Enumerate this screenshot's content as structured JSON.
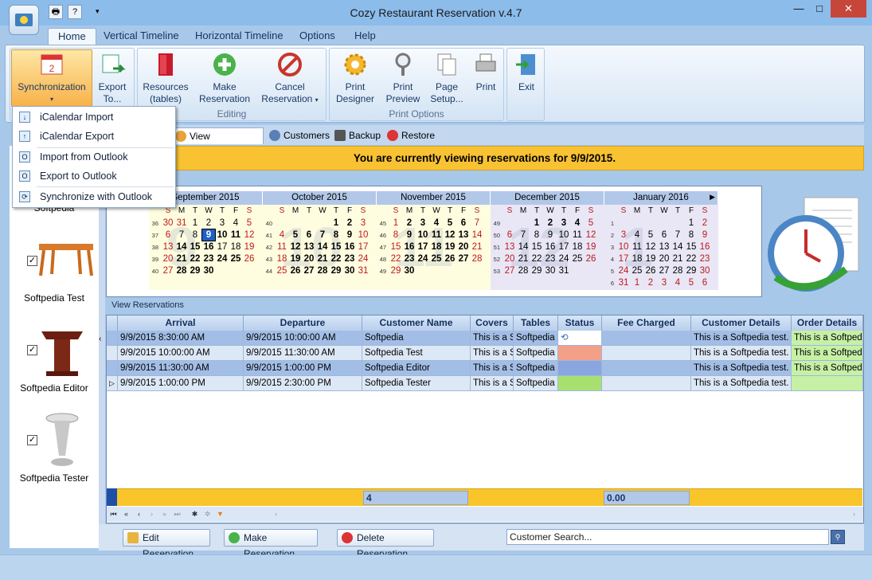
{
  "window": {
    "title": "Cozy Restaurant Reservation v.4.7",
    "minimize": "—",
    "maximize": "□",
    "close": "✕"
  },
  "ribbon_tabs": [
    "Home",
    "Vertical Timeline",
    "Horizontal Timeline",
    "Options",
    "Help"
  ],
  "ribbon": {
    "sync": "Synchronization",
    "export1": "Export",
    "export2": "To...",
    "resources1": "Resources",
    "resources2": "(tables)",
    "make1": "Make",
    "make2": "Reservation",
    "cancel1": "Cancel",
    "cancel2": "Reservation",
    "print_designer1": "Print",
    "print_designer2": "Designer",
    "print_preview1": "Print",
    "print_preview2": "Preview",
    "page_setup1": "Page",
    "page_setup2": "Setup...",
    "print": "Print",
    "exit": "Exit",
    "group_editing": "Editing",
    "group_print": "Print Options"
  },
  "dropdown": [
    "iCalendar Import",
    "iCalendar Export",
    "Import from Outlook",
    "Export to Outlook",
    "Synchronize with Outlook"
  ],
  "view_tabs": [
    "View Reservations",
    "Customers",
    "Backup",
    "Restore"
  ],
  "banner": "You are currently viewing reservations for 9/9/2015.",
  "resources": [
    {
      "name": "Softpedia",
      "checked": true
    },
    {
      "name": "Softpedia Test",
      "checked": true
    },
    {
      "name": "Softpedia Editor",
      "checked": true
    },
    {
      "name": "Softpedia Tester",
      "checked": true
    }
  ],
  "calendar": {
    "dow": [
      "S",
      "M",
      "T",
      "W",
      "T",
      "F",
      "S"
    ],
    "months": [
      {
        "name": "September 2015",
        "watermark": "9",
        "weeks": [
          36,
          37,
          38,
          39,
          40
        ],
        "days": [
          [
            [
              "30",
              1
            ],
            [
              "31",
              1
            ],
            [
              "1",
              0
            ],
            [
              "2",
              0
            ],
            [
              "3",
              0
            ],
            [
              "4",
              0
            ],
            [
              "5",
              0
            ]
          ],
          [
            [
              "6",
              0
            ],
            [
              "7",
              0
            ],
            [
              "8",
              0
            ],
            [
              "9",
              0
            ],
            [
              "10",
              0
            ],
            [
              "11",
              0
            ],
            [
              "12",
              0
            ]
          ],
          [
            [
              "13",
              0
            ],
            [
              "14",
              0
            ],
            [
              "15",
              0
            ],
            [
              "16",
              0
            ],
            [
              "17",
              0
            ],
            [
              "18",
              0
            ],
            [
              "19",
              0
            ]
          ],
          [
            [
              "20",
              0
            ],
            [
              "21",
              0
            ],
            [
              "22",
              0
            ],
            [
              "23",
              0
            ],
            [
              "24",
              0
            ],
            [
              "25",
              0
            ],
            [
              "26",
              0
            ]
          ],
          [
            [
              "27",
              0
            ],
            [
              "28",
              0
            ],
            [
              "29",
              0
            ],
            [
              "30",
              0
            ],
            [
              "",
              0
            ],
            [
              "",
              0
            ],
            [
              "",
              0
            ]
          ]
        ]
      },
      {
        "name": "October 2015",
        "watermark": "10",
        "weeks": [
          40,
          41,
          42,
          43,
          44
        ],
        "days": [
          [
            [
              "",
              0
            ],
            [
              "",
              0
            ],
            [
              "",
              0
            ],
            [
              "",
              0
            ],
            [
              "1",
              0
            ],
            [
              "2",
              0
            ],
            [
              "3",
              0
            ]
          ],
          [
            [
              "4",
              0
            ],
            [
              "5",
              0
            ],
            [
              "6",
              0
            ],
            [
              "7",
              0
            ],
            [
              "8",
              0
            ],
            [
              "9",
              0
            ],
            [
              "10",
              0
            ]
          ],
          [
            [
              "11",
              0
            ],
            [
              "12",
              0
            ],
            [
              "13",
              0
            ],
            [
              "14",
              0
            ],
            [
              "15",
              0
            ],
            [
              "16",
              0
            ],
            [
              "17",
              0
            ]
          ],
          [
            [
              "18",
              0
            ],
            [
              "19",
              0
            ],
            [
              "20",
              0
            ],
            [
              "21",
              0
            ],
            [
              "22",
              0
            ],
            [
              "23",
              0
            ],
            [
              "24",
              0
            ]
          ],
          [
            [
              "25",
              0
            ],
            [
              "26",
              0
            ],
            [
              "27",
              0
            ],
            [
              "28",
              0
            ],
            [
              "29",
              0
            ],
            [
              "30",
              0
            ],
            [
              "31",
              0
            ]
          ]
        ]
      },
      {
        "name": "November 2015",
        "watermark": "11",
        "weeks": [
          45,
          46,
          47,
          48,
          49
        ],
        "days": [
          [
            [
              "1",
              0
            ],
            [
              "2",
              0
            ],
            [
              "3",
              0
            ],
            [
              "4",
              0
            ],
            [
              "5",
              0
            ],
            [
              "6",
              0
            ],
            [
              "7",
              0
            ]
          ],
          [
            [
              "8",
              0
            ],
            [
              "9",
              0
            ],
            [
              "10",
              0
            ],
            [
              "11",
              0
            ],
            [
              "12",
              0
            ],
            [
              "13",
              0
            ],
            [
              "14",
              0
            ]
          ],
          [
            [
              "15",
              0
            ],
            [
              "16",
              0
            ],
            [
              "17",
              0
            ],
            [
              "18",
              0
            ],
            [
              "19",
              0
            ],
            [
              "20",
              0
            ],
            [
              "21",
              0
            ]
          ],
          [
            [
              "22",
              0
            ],
            [
              "23",
              0
            ],
            [
              "24",
              0
            ],
            [
              "25",
              0
            ],
            [
              "26",
              0
            ],
            [
              "27",
              0
            ],
            [
              "28",
              0
            ]
          ],
          [
            [
              "29",
              0
            ],
            [
              "30",
              0
            ],
            [
              "",
              0
            ],
            [
              "",
              0
            ],
            [
              "",
              0
            ],
            [
              "",
              0
            ],
            [
              "",
              0
            ]
          ]
        ]
      },
      {
        "name": "December 2015",
        "watermark": "12",
        "weeks": [
          49,
          50,
          51,
          52,
          53
        ],
        "days": [
          [
            [
              "",
              0
            ],
            [
              "",
              0
            ],
            [
              "1",
              0
            ],
            [
              "2",
              0
            ],
            [
              "3",
              0
            ],
            [
              "4",
              0
            ],
            [
              "5",
              0
            ]
          ],
          [
            [
              "6",
              0
            ],
            [
              "7",
              0
            ],
            [
              "8",
              0
            ],
            [
              "9",
              0
            ],
            [
              "10",
              0
            ],
            [
              "11",
              0
            ],
            [
              "12",
              0
            ]
          ],
          [
            [
              "13",
              0
            ],
            [
              "14",
              0
            ],
            [
              "15",
              0
            ],
            [
              "16",
              0
            ],
            [
              "17",
              0
            ],
            [
              "18",
              0
            ],
            [
              "19",
              0
            ]
          ],
          [
            [
              "20",
              0
            ],
            [
              "21",
              0
            ],
            [
              "22",
              0
            ],
            [
              "23",
              0
            ],
            [
              "24",
              0
            ],
            [
              "25",
              0
            ],
            [
              "26",
              0
            ]
          ],
          [
            [
              "27",
              0
            ],
            [
              "28",
              0
            ],
            [
              "29",
              0
            ],
            [
              "30",
              0
            ],
            [
              "31",
              0
            ],
            [
              "",
              0
            ],
            [
              "",
              0
            ]
          ]
        ]
      },
      {
        "name": "January 2016",
        "watermark": "1",
        "weeks": [
          1,
          2,
          3,
          4,
          5,
          6
        ],
        "days": [
          [
            [
              "",
              0
            ],
            [
              "",
              0
            ],
            [
              "",
              0
            ],
            [
              "",
              0
            ],
            [
              "",
              0
            ],
            [
              "1",
              0
            ],
            [
              "2",
              0
            ]
          ],
          [
            [
              "3",
              0
            ],
            [
              "4",
              0
            ],
            [
              "5",
              0
            ],
            [
              "6",
              0
            ],
            [
              "7",
              0
            ],
            [
              "8",
              0
            ],
            [
              "9",
              0
            ]
          ],
          [
            [
              "10",
              0
            ],
            [
              "11",
              0
            ],
            [
              "12",
              0
            ],
            [
              "13",
              0
            ],
            [
              "14",
              0
            ],
            [
              "15",
              0
            ],
            [
              "16",
              0
            ]
          ],
          [
            [
              "17",
              0
            ],
            [
              "18",
              0
            ],
            [
              "19",
              0
            ],
            [
              "20",
              0
            ],
            [
              "21",
              0
            ],
            [
              "22",
              0
            ],
            [
              "23",
              0
            ]
          ],
          [
            [
              "24",
              0
            ],
            [
              "25",
              0
            ],
            [
              "26",
              0
            ],
            [
              "27",
              0
            ],
            [
              "28",
              0
            ],
            [
              "29",
              0
            ],
            [
              "30",
              0
            ]
          ],
          [
            [
              "31",
              0
            ],
            [
              "1",
              1
            ],
            [
              "2",
              1
            ],
            [
              "3",
              1
            ],
            [
              "4",
              1
            ],
            [
              "5",
              1
            ],
            [
              "6",
              1
            ]
          ]
        ]
      }
    ],
    "bold_days": {
      "September 2015": [
        "9",
        "10",
        "11",
        "14",
        "15",
        "16",
        "21",
        "22",
        "23",
        "24",
        "25",
        "28",
        "29",
        "30"
      ],
      "October 2015": [
        "1",
        "2",
        "5",
        "6",
        "7",
        "8",
        "9",
        "12",
        "13",
        "14",
        "15",
        "16",
        "19",
        "20",
        "21",
        "22",
        "23",
        "26",
        "27",
        "28",
        "29",
        "30"
      ],
      "November 2015": [
        "2",
        "3",
        "4",
        "5",
        "6",
        "9",
        "10",
        "11",
        "12",
        "13",
        "16",
        "17",
        "18",
        "19",
        "20",
        "23",
        "24",
        "25",
        "26",
        "27",
        "30"
      ],
      "December 2015": [
        "1",
        "2",
        "3",
        "4"
      ]
    },
    "selected": "9"
  },
  "grid_label": "View Reservations",
  "columns": [
    "Arrival",
    "Departure",
    "Customer Name",
    "Covers",
    "Tables",
    "Status",
    "Fee Charged",
    "Customer Details",
    "Order Details"
  ],
  "rows": [
    {
      "arrival": "9/9/2015 8:30:00 AM",
      "departure": "9/9/2015 10:00:00 AM",
      "customer": "Softpedia",
      "covers": "This is a Sc",
      "tables": "Softpedia",
      "status": "#ffffff",
      "fee": "",
      "details": "This is a Softpedia test.",
      "order": "This is a Softpedia"
    },
    {
      "arrival": "9/9/2015 10:00:00 AM",
      "departure": "9/9/2015 11:30:00 AM",
      "customer": "Softpedia Test",
      "covers": "This is a Sc",
      "tables": "Softpedia T",
      "status": "#f4a089",
      "fee": "",
      "details": "This is a Softpedia test.",
      "order": "This is a Softpedia"
    },
    {
      "arrival": "9/9/2015 11:30:00 AM",
      "departure": "9/9/2015 1:00:00 PM",
      "customer": "Softpedia Editor",
      "covers": "This is a Sc",
      "tables": "Softpedia E",
      "status": "#8aa6e0",
      "fee": "",
      "details": "This is a Softpedia test.",
      "order": "This is a Softpedia"
    },
    {
      "arrival": "9/9/2015 1:00:00 PM",
      "departure": "9/9/2015 2:30:00 PM",
      "customer": "Softpedia Tester",
      "covers": "This is a Sc",
      "tables": "Softpedia T",
      "status": "#a8e070",
      "fee": "",
      "details": "This is a Softpedia test.",
      "order": ""
    }
  ],
  "footer": {
    "count": "4",
    "fee_total": "0.00"
  },
  "buttons": {
    "edit": "Edit Reservation",
    "make": "Make Reservation",
    "delete": "Delete Reservation"
  },
  "search": {
    "placeholder": "Customer Search..."
  }
}
